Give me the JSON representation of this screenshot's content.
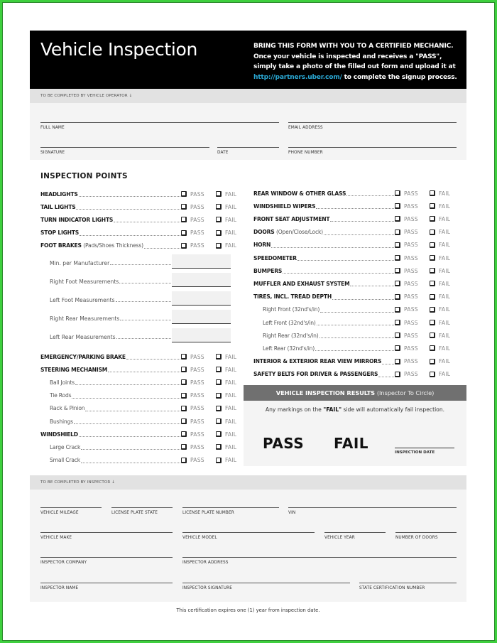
{
  "header": {
    "title": "Vehicle Inspection",
    "instruction_heading": "BRING THIS FORM WITH YOU TO A CERTIFIED MECHANIC.",
    "instruction_body_1": "Once your vehicle is inspected and receives a ",
    "instruction_pass": "\"PASS\"",
    "instruction_body_2": ", simply take a photo of the filled out form and upload it at ",
    "link": "http://partners.uber.com/",
    "instruction_body_3": " to complete the signup process.",
    "link_color": "#2aa8d4"
  },
  "operator_section": {
    "band_label": "TO BE COMPLETED BY VEHICLE OPERATOR ↓",
    "fields": {
      "full_name": "FULL NAME",
      "email": "EMAIL ADDRESS",
      "signature": "SIGNATURE",
      "date": "DATE",
      "phone": "PHONE NUMBER"
    }
  },
  "inspection": {
    "title": "INSPECTION POINTS",
    "pass_label": "PASS",
    "fail_label": "FAIL",
    "left_items": [
      {
        "name": "HEADLIGHTS",
        "sub": ""
      },
      {
        "name": "TAIL LIGHTS",
        "sub": ""
      },
      {
        "name": "TURN INDICATOR LIGHTS",
        "sub": ""
      },
      {
        "name": "STOP LIGHTS",
        "sub": ""
      },
      {
        "name": "FOOT BRAKES ",
        "sub": "(Pads/Shoes Thickness)"
      }
    ],
    "measurements": [
      "Min. per Manufacturer",
      "Right Foot Measurements",
      "Left Foot Measurements",
      "Right Rear Measurements",
      "Left Rear Measurements"
    ],
    "left_items_2": [
      {
        "name": "EMERGENCY/PARKING BRAKE",
        "indent": false
      },
      {
        "name": "STEERING MECHANISM",
        "indent": false
      },
      {
        "name": "Ball Joints",
        "indent": true
      },
      {
        "name": "Tie Rods",
        "indent": true
      },
      {
        "name": "Rack & Pinion",
        "indent": true
      },
      {
        "name": "Bushings",
        "indent": true
      },
      {
        "name": "WINDSHIELD",
        "indent": false
      },
      {
        "name": "Large Crack",
        "indent": true
      },
      {
        "name": "Small Crack",
        "indent": true
      }
    ],
    "right_items": [
      {
        "name": "REAR WINDOW & OTHER GLASS",
        "sub": "",
        "indent": false
      },
      {
        "name": "WINDSHIELD WIPERS",
        "sub": "",
        "indent": false
      },
      {
        "name": "FRONT SEAT ADJUSTMENT",
        "sub": "",
        "indent": false
      },
      {
        "name": "DOORS ",
        "sub": "(Open/Close/Lock)",
        "indent": false
      },
      {
        "name": "HORN",
        "sub": "",
        "indent": false
      },
      {
        "name": "SPEEDOMETER",
        "sub": "",
        "indent": false
      },
      {
        "name": "BUMPERS",
        "sub": "",
        "indent": false
      },
      {
        "name": "MUFFLER AND EXHAUST SYSTEM",
        "sub": "",
        "indent": false
      },
      {
        "name": "TIRES, INCL. TREAD DEPTH",
        "sub": "",
        "indent": false
      },
      {
        "name": "Right Front (32nd's/in)",
        "sub": "",
        "indent": true
      },
      {
        "name": "Left Front (32nd's/in)",
        "sub": "",
        "indent": true
      },
      {
        "name": "Right Rear (32nd's/in)",
        "sub": "",
        "indent": true
      },
      {
        "name": "Left Rear (32nd's/in)",
        "sub": "",
        "indent": true
      },
      {
        "name": "INTERIOR & EXTERIOR REAR VIEW MIRRORS",
        "sub": "",
        "indent": false
      },
      {
        "name": "SAFETY BELTS FOR DRIVER & PASSENGERS",
        "sub": "",
        "indent": false
      }
    ]
  },
  "results": {
    "heading": "VEHICLE INSPECTION RESULTS ",
    "heading_sub": "(Inspector To Circle)",
    "note_1": "Any markings on the ",
    "note_fail": "\"FAIL\"",
    "note_2": " side will automatically fail inspection.",
    "pass": "PASS",
    "fail": "FAIL",
    "date_label": "INSPECTION DATE"
  },
  "inspector_section": {
    "band_label": "TO BE COMPLETED BY INSPECTOR ↓",
    "fields": {
      "mileage": "VEHICLE MILEAGE",
      "plate_state": "LICENSE PLATE STATE",
      "plate_number": "LICENSE PLATE NUMBER",
      "vin": "VIN",
      "make": "VEHICLE MAKE",
      "model": "VEHICLE MODEL",
      "year": "VEHICLE YEAR",
      "doors": "NUMBER OF DOORS",
      "company": "INSPECTOR COMPANY",
      "address": "INSPECTOR ADDRESS",
      "name": "INSPECTOR NAME",
      "signature": "INSPECTOR SIGNATURE",
      "cert_number": "STATE CERTIFICATION NUMBER"
    }
  },
  "footer": "This certification expires one (1) year from inspection date."
}
